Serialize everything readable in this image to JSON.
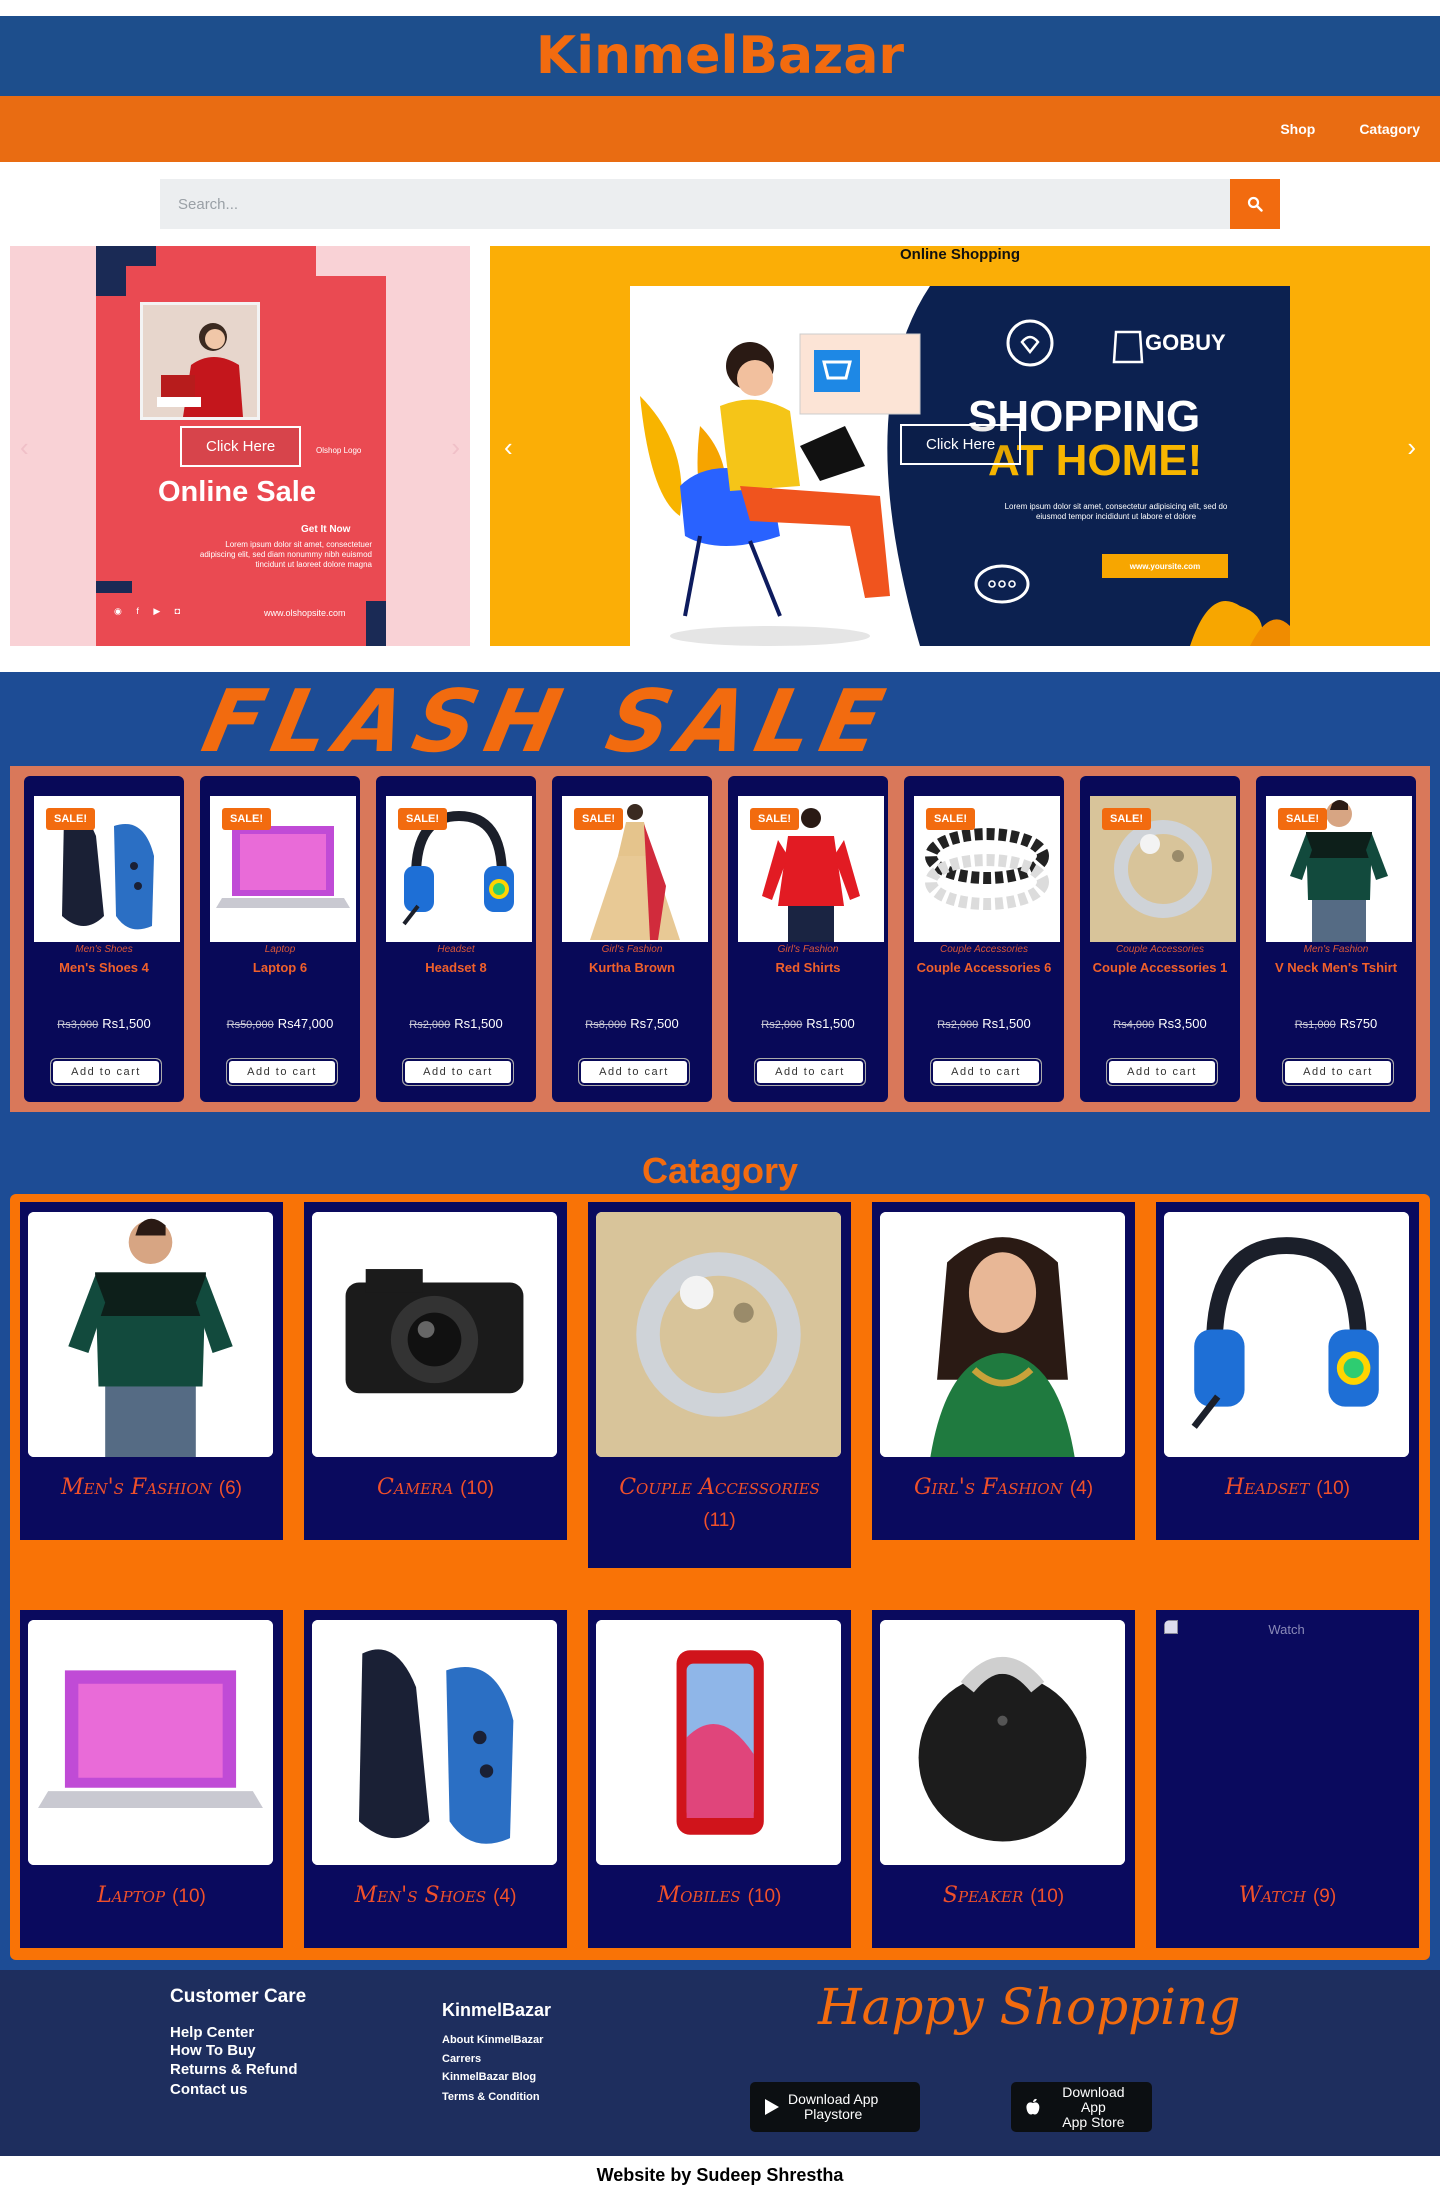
{
  "header": {
    "brand": "KinmelBazar",
    "nav": [
      {
        "label": "Shop"
      },
      {
        "label": "Catagory"
      }
    ]
  },
  "search": {
    "placeholder": "Search..."
  },
  "banners": {
    "left": {
      "click_label": "Click Here",
      "logo_text": "Olshop Logo",
      "headline": "Online Sale",
      "cta": "Get It Now",
      "body": "Lorem ipsum dolor sit amet, consectetuer adipiscing elit, sed diam nonummy nibh euismod tincidunt ut laoreet dolore magna",
      "site": "www.olshopsite.com"
    },
    "right": {
      "caption": "Online Shopping",
      "click_label": "Click Here",
      "brand": "GOBUY",
      "headline_1": "SHOPPING",
      "headline_2": "AT HOME!",
      "body": "Lorem ipsum dolor sit amet, consectetur adipisicing elit, sed do eiusmod tempor incididunt ut labore et dolore",
      "site": "www.yoursite.com"
    }
  },
  "flash_sale": {
    "title": "FLASH SALE",
    "badge": "SALE!",
    "add_label": "Add to cart",
    "products": [
      {
        "category": "Men's Shoes",
        "name": "Men's Shoes 4",
        "old_price": "Rs3,000",
        "price": "Rs1,500",
        "icon": "shoe-icon"
      },
      {
        "category": "Laptop",
        "name": "Laptop 6",
        "old_price": "Rs50,000",
        "price": "Rs47,000",
        "icon": "laptop-icon"
      },
      {
        "category": "Headset",
        "name": "Headset 8",
        "old_price": "Rs2,000",
        "price": "Rs1,500",
        "icon": "headset-icon"
      },
      {
        "category": "Girl's Fashion",
        "name": "Kurtha Brown",
        "old_price": "Rs8,000",
        "price": "Rs7,500",
        "icon": "dress-icon"
      },
      {
        "category": "Girl's Fashion",
        "name": "Red Shirts",
        "old_price": "Rs2,000",
        "price": "Rs1,500",
        "icon": "shirt-icon"
      },
      {
        "category": "Couple Accessories",
        "name": "Couple Accessories 6",
        "old_price": "Rs2,000",
        "price": "Rs1,500",
        "icon": "bracelet-icon"
      },
      {
        "category": "Couple Accessories",
        "name": "Couple Accessories 1",
        "old_price": "Rs4,000",
        "price": "Rs3,500",
        "icon": "ring-icon"
      },
      {
        "category": "Men's Fashion",
        "name": "V Neck Men's Tshirt",
        "old_price": "Rs1,000",
        "price": "Rs750",
        "icon": "tshirt-icon"
      }
    ]
  },
  "categories": {
    "title": "Catagory",
    "items": [
      {
        "name": "Men's Fashion",
        "count": "(6)",
        "icon": "tshirt-icon"
      },
      {
        "name": "Camera",
        "count": "(10)",
        "icon": "camera-icon"
      },
      {
        "name": "Couple Accessories",
        "count": "(11)",
        "icon": "ring-icon"
      },
      {
        "name": "Girl's Fashion",
        "count": "(4)",
        "icon": "woman-icon"
      },
      {
        "name": "Headset",
        "count": "(10)",
        "icon": "headset-icon"
      },
      {
        "name": "Laptop",
        "count": "(10)",
        "icon": "laptop-icon"
      },
      {
        "name": "Men's Shoes",
        "count": "(4)",
        "icon": "shoe-icon"
      },
      {
        "name": "Mobiles",
        "count": "(10)",
        "icon": "phone-icon"
      },
      {
        "name": "Speaker",
        "count": "(10)",
        "icon": "speaker-icon"
      },
      {
        "name": "Watch",
        "count": "(9)",
        "icon": "broken-image-icon",
        "alt": "Watch"
      }
    ]
  },
  "footer": {
    "care_title": "Customer Care",
    "care_links": [
      "Help Center",
      "How To Buy",
      "Returns & Refund",
      "Contact us"
    ],
    "brand_title": "KinmelBazar",
    "brand_links": [
      "About KinmelBazar",
      "Carrers",
      "KinmelBazar Blog",
      "Terms & Condition"
    ],
    "tagline": "Happy Shopping",
    "playstore_1": "Download App",
    "playstore_2": "Playstore",
    "appstore_1": "Download App",
    "appstore_2": "App Store",
    "credit": "Website by Sudeep Shrestha"
  },
  "colors": {
    "brand_blue": "#1d4e8c",
    "brand_orange": "#f26b0f",
    "card_navy": "#080958"
  }
}
